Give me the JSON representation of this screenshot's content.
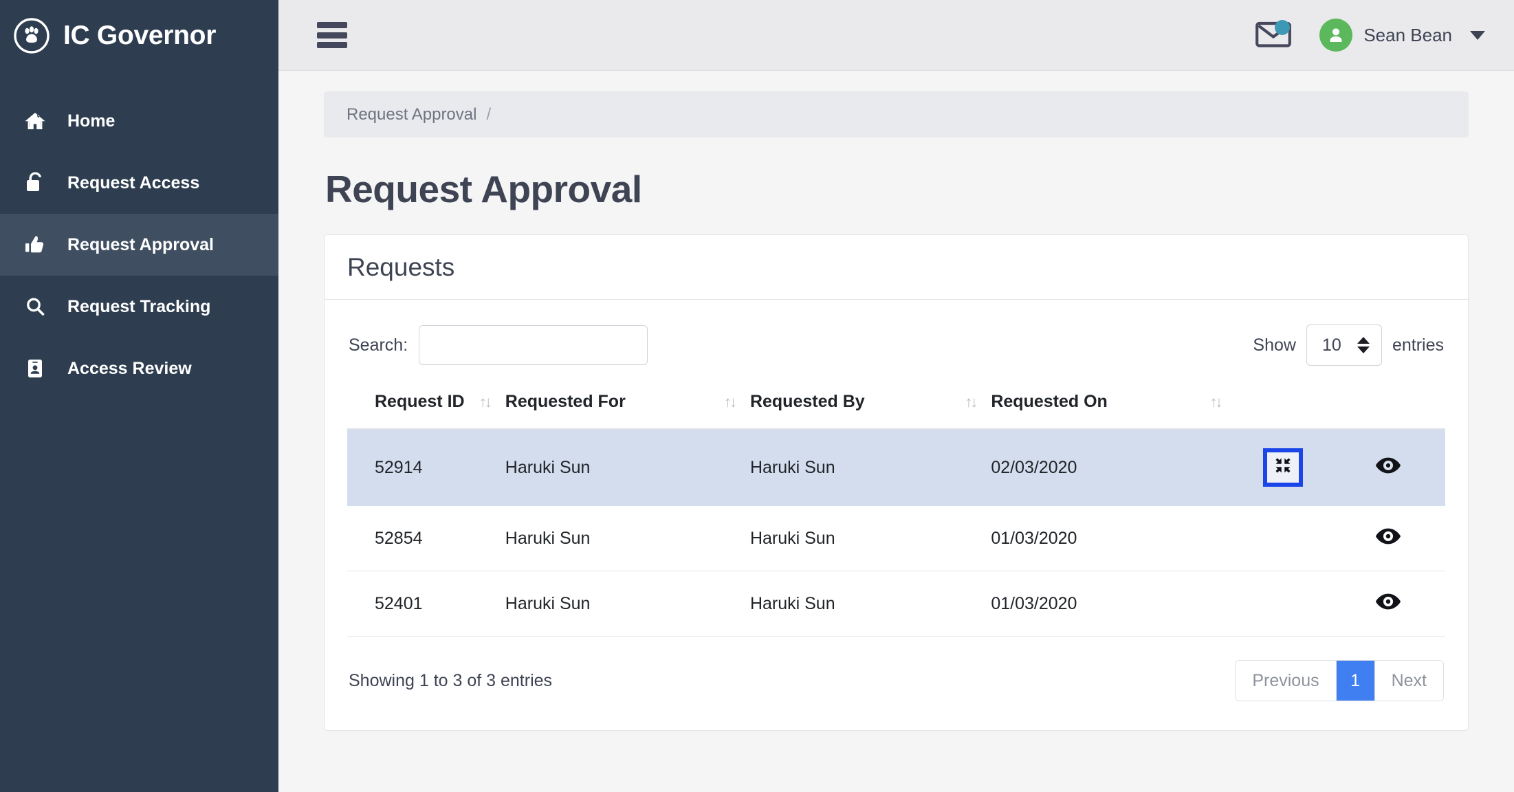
{
  "brand": {
    "title": "IC Governor",
    "logo_icon": "paw-circle-icon"
  },
  "sidebar": {
    "items": [
      {
        "label": "Home",
        "icon": "home-icon",
        "active": false
      },
      {
        "label": "Request Access",
        "icon": "unlock-icon",
        "active": false
      },
      {
        "label": "Request Approval",
        "icon": "thumbs-up-icon",
        "active": true
      },
      {
        "label": "Request Tracking",
        "icon": "search-icon",
        "active": false
      },
      {
        "label": "Access Review",
        "icon": "id-badge-icon",
        "active": false
      }
    ]
  },
  "topbar": {
    "menu_toggle_icon": "hamburger-icon",
    "mail_icon": "envelope-icon",
    "mail_has_notification": true,
    "notification_dot_color": "#3d98b5",
    "avatar_icon": "user-icon",
    "avatar_color": "#5cb85c",
    "user_name": "Sean Bean",
    "caret_icon": "caret-down-icon"
  },
  "breadcrumb": {
    "items": [
      "Request Approval"
    ],
    "separator": "/"
  },
  "page": {
    "title": "Request Approval"
  },
  "card": {
    "title": "Requests"
  },
  "datatable": {
    "search_label": "Search:",
    "search_value": "",
    "search_placeholder": "",
    "length_prefix": "Show",
    "length_value": "10",
    "length_suffix": "entries",
    "sort_icon": "↑↓",
    "columns": [
      {
        "key": "request_id",
        "label": "Request ID",
        "sortable": true
      },
      {
        "key": "requested_for",
        "label": "Requested For",
        "sortable": true
      },
      {
        "key": "requested_by",
        "label": "Requested By",
        "sortable": true
      },
      {
        "key": "requested_on",
        "label": "Requested On",
        "sortable": true
      },
      {
        "key": "action",
        "label": "",
        "sortable": false
      },
      {
        "key": "view",
        "label": "",
        "sortable": false
      }
    ],
    "rows": [
      {
        "request_id": "52914",
        "requested_for": "Haruki Sun",
        "requested_by": "Haruki Sun",
        "requested_on": "02/03/2020",
        "selected": true,
        "action_icon": "compress-arrows-icon",
        "action_focused": true,
        "view_icon": "eye-icon"
      },
      {
        "request_id": "52854",
        "requested_for": "Haruki Sun",
        "requested_by": "Haruki Sun",
        "requested_on": "01/03/2020",
        "selected": false,
        "action_icon": null,
        "action_focused": false,
        "view_icon": "eye-icon"
      },
      {
        "request_id": "52401",
        "requested_for": "Haruki Sun",
        "requested_by": "Haruki Sun",
        "requested_on": "01/03/2020",
        "selected": false,
        "action_icon": null,
        "action_focused": false,
        "view_icon": "eye-icon"
      }
    ],
    "info_text": "Showing 1 to 3 of 3 entries",
    "pagination": {
      "previous_label": "Previous",
      "next_label": "Next",
      "pages": [
        "1"
      ],
      "active_page": "1",
      "active_color": "#3f7ff2"
    }
  },
  "colors": {
    "sidebar_bg": "#2e3e50",
    "sidebar_active_bg": "#3f4e61",
    "topbar_bg": "#eaeaec",
    "page_bg": "#f5f5f6",
    "breadcrumb_bg": "#e9eaee",
    "row_selected_bg": "#d3ddee",
    "focus_outline": "#1b45e8",
    "text": "#3f4454"
  }
}
